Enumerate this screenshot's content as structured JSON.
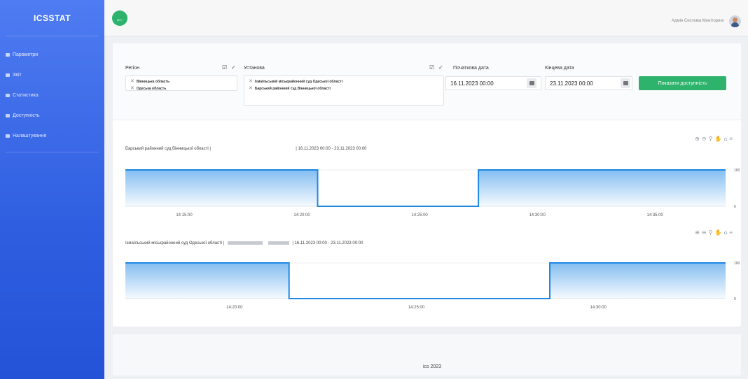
{
  "sidebar": {
    "brand": "ICSSTAT",
    "items": [
      {
        "label": "Параметри"
      },
      {
        "label": "Звіт"
      },
      {
        "label": "Статистика"
      },
      {
        "label": "Доступність"
      },
      {
        "label": "Налаштування"
      }
    ]
  },
  "topbar": {
    "user_name": "Адмін Система Моніторинг"
  },
  "filters": {
    "region_label": "Регіон",
    "region_tags": [
      "Вінницька область",
      "Одеська область"
    ],
    "institution_label": "Установа",
    "institution_tags": [
      "Ізмаїльський міськрайонний суд Одеської області",
      "Барський районний суд Вінницької області"
    ],
    "start_label": "Початкова дата",
    "start_value": "16.11.2023 00:00",
    "end_label": "Кінцева дата",
    "end_value": "23.11.2023 00:00",
    "show_button": "Показати доступність"
  },
  "charts": [
    {
      "title_prefix": "Барський районний суд Вінницької області |",
      "title_suffix": "| 16.11.2023 00:00 - 23.11.2023 00:00"
    },
    {
      "title_prefix": "Ізмаїльський міськрайонний суд Одеської області |",
      "title_suffix": "| 16.11.2023 00:00 - 23.11.2023 00:00"
    }
  ],
  "chart_data": [
    {
      "type": "area",
      "title": "",
      "x": [
        "14:12:30",
        "14:20:40",
        "14:20:40",
        "14:27:30",
        "14:27:30",
        "14:38:00"
      ],
      "x_ticks": [
        "14:15:00",
        "14:20:00",
        "14:25:00",
        "14:30:00",
        "14:35:00"
      ],
      "y_ticks": [
        "100",
        "0"
      ],
      "ylim": [
        0,
        100
      ],
      "series": [
        {
          "values": [
            100,
            100,
            0,
            0,
            100,
            100
          ]
        }
      ]
    },
    {
      "type": "area",
      "title": "",
      "x": [
        "14:17:00",
        "14:21:30",
        "14:21:30",
        "14:28:40",
        "14:28:40",
        "14:33:30"
      ],
      "x_ticks": [
        "14:20:00",
        "14:25:00",
        "14:30:00"
      ],
      "y_ticks": [
        "100",
        "0"
      ],
      "ylim": [
        0,
        100
      ],
      "series": [
        {
          "values": [
            100,
            100,
            0,
            0,
            100,
            100
          ]
        }
      ]
    }
  ],
  "footer": {
    "text": "ics 2023"
  },
  "colors": {
    "accent_green": "#2db36b",
    "sidebar_blue": "#2f5ee0",
    "line_blue": "#1e88e5"
  }
}
